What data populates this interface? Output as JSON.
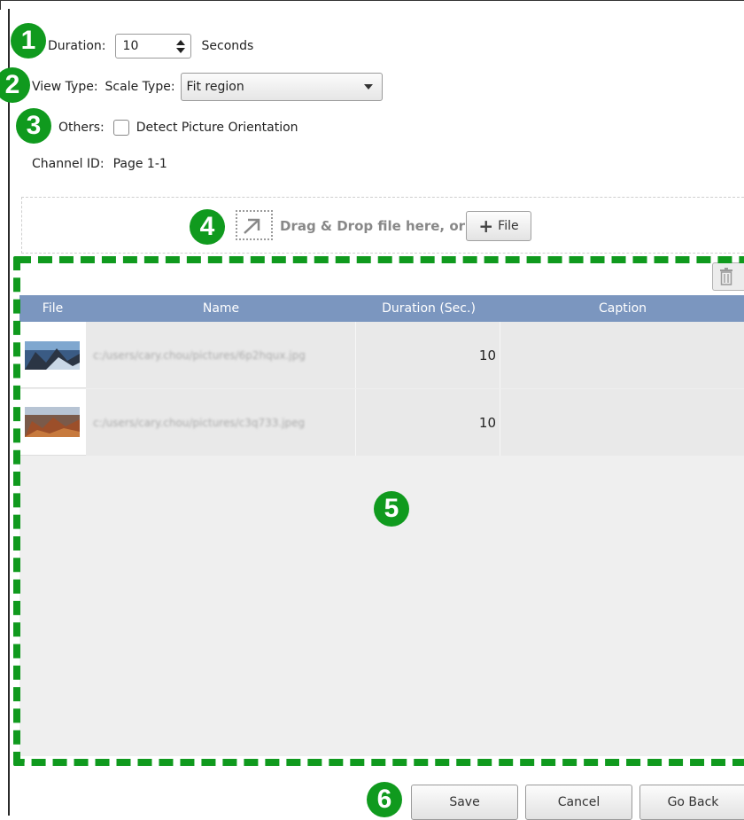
{
  "form": {
    "duration_label": "Duration:",
    "duration_value": "10",
    "duration_unit": "Seconds",
    "view_type_label": "View Type:",
    "scale_type_label": "Scale Type:",
    "scale_type_value": "Fit region",
    "others_label": "Others:",
    "detect_orientation_label": "Detect Picture Orientation",
    "detect_orientation_checked": false,
    "channel_id_label": "Channel ID:",
    "channel_id_value": "Page 1-1"
  },
  "drop_zone": {
    "text": "Drag & Drop file here, or",
    "file_button_label": "File"
  },
  "table": {
    "columns": [
      "File",
      "Name",
      "Duration (Sec.)",
      "Caption"
    ],
    "rows": [
      {
        "name": "c:/users/cary.chou/pictures/6p2hqux.jpg",
        "duration": "10",
        "caption": ""
      },
      {
        "name": "c:/users/cary.chou/pictures/c3q733.jpeg",
        "duration": "10",
        "caption": ""
      }
    ]
  },
  "actions": {
    "save_label": "Save",
    "cancel_label": "Cancel",
    "go_back_label": "Go Back"
  },
  "callouts": [
    "1",
    "2",
    "3",
    "4",
    "5",
    "6"
  ],
  "colors": {
    "callout_green": "#109a1e",
    "table_header": "#7b96bf",
    "table_body": "#efefef"
  }
}
